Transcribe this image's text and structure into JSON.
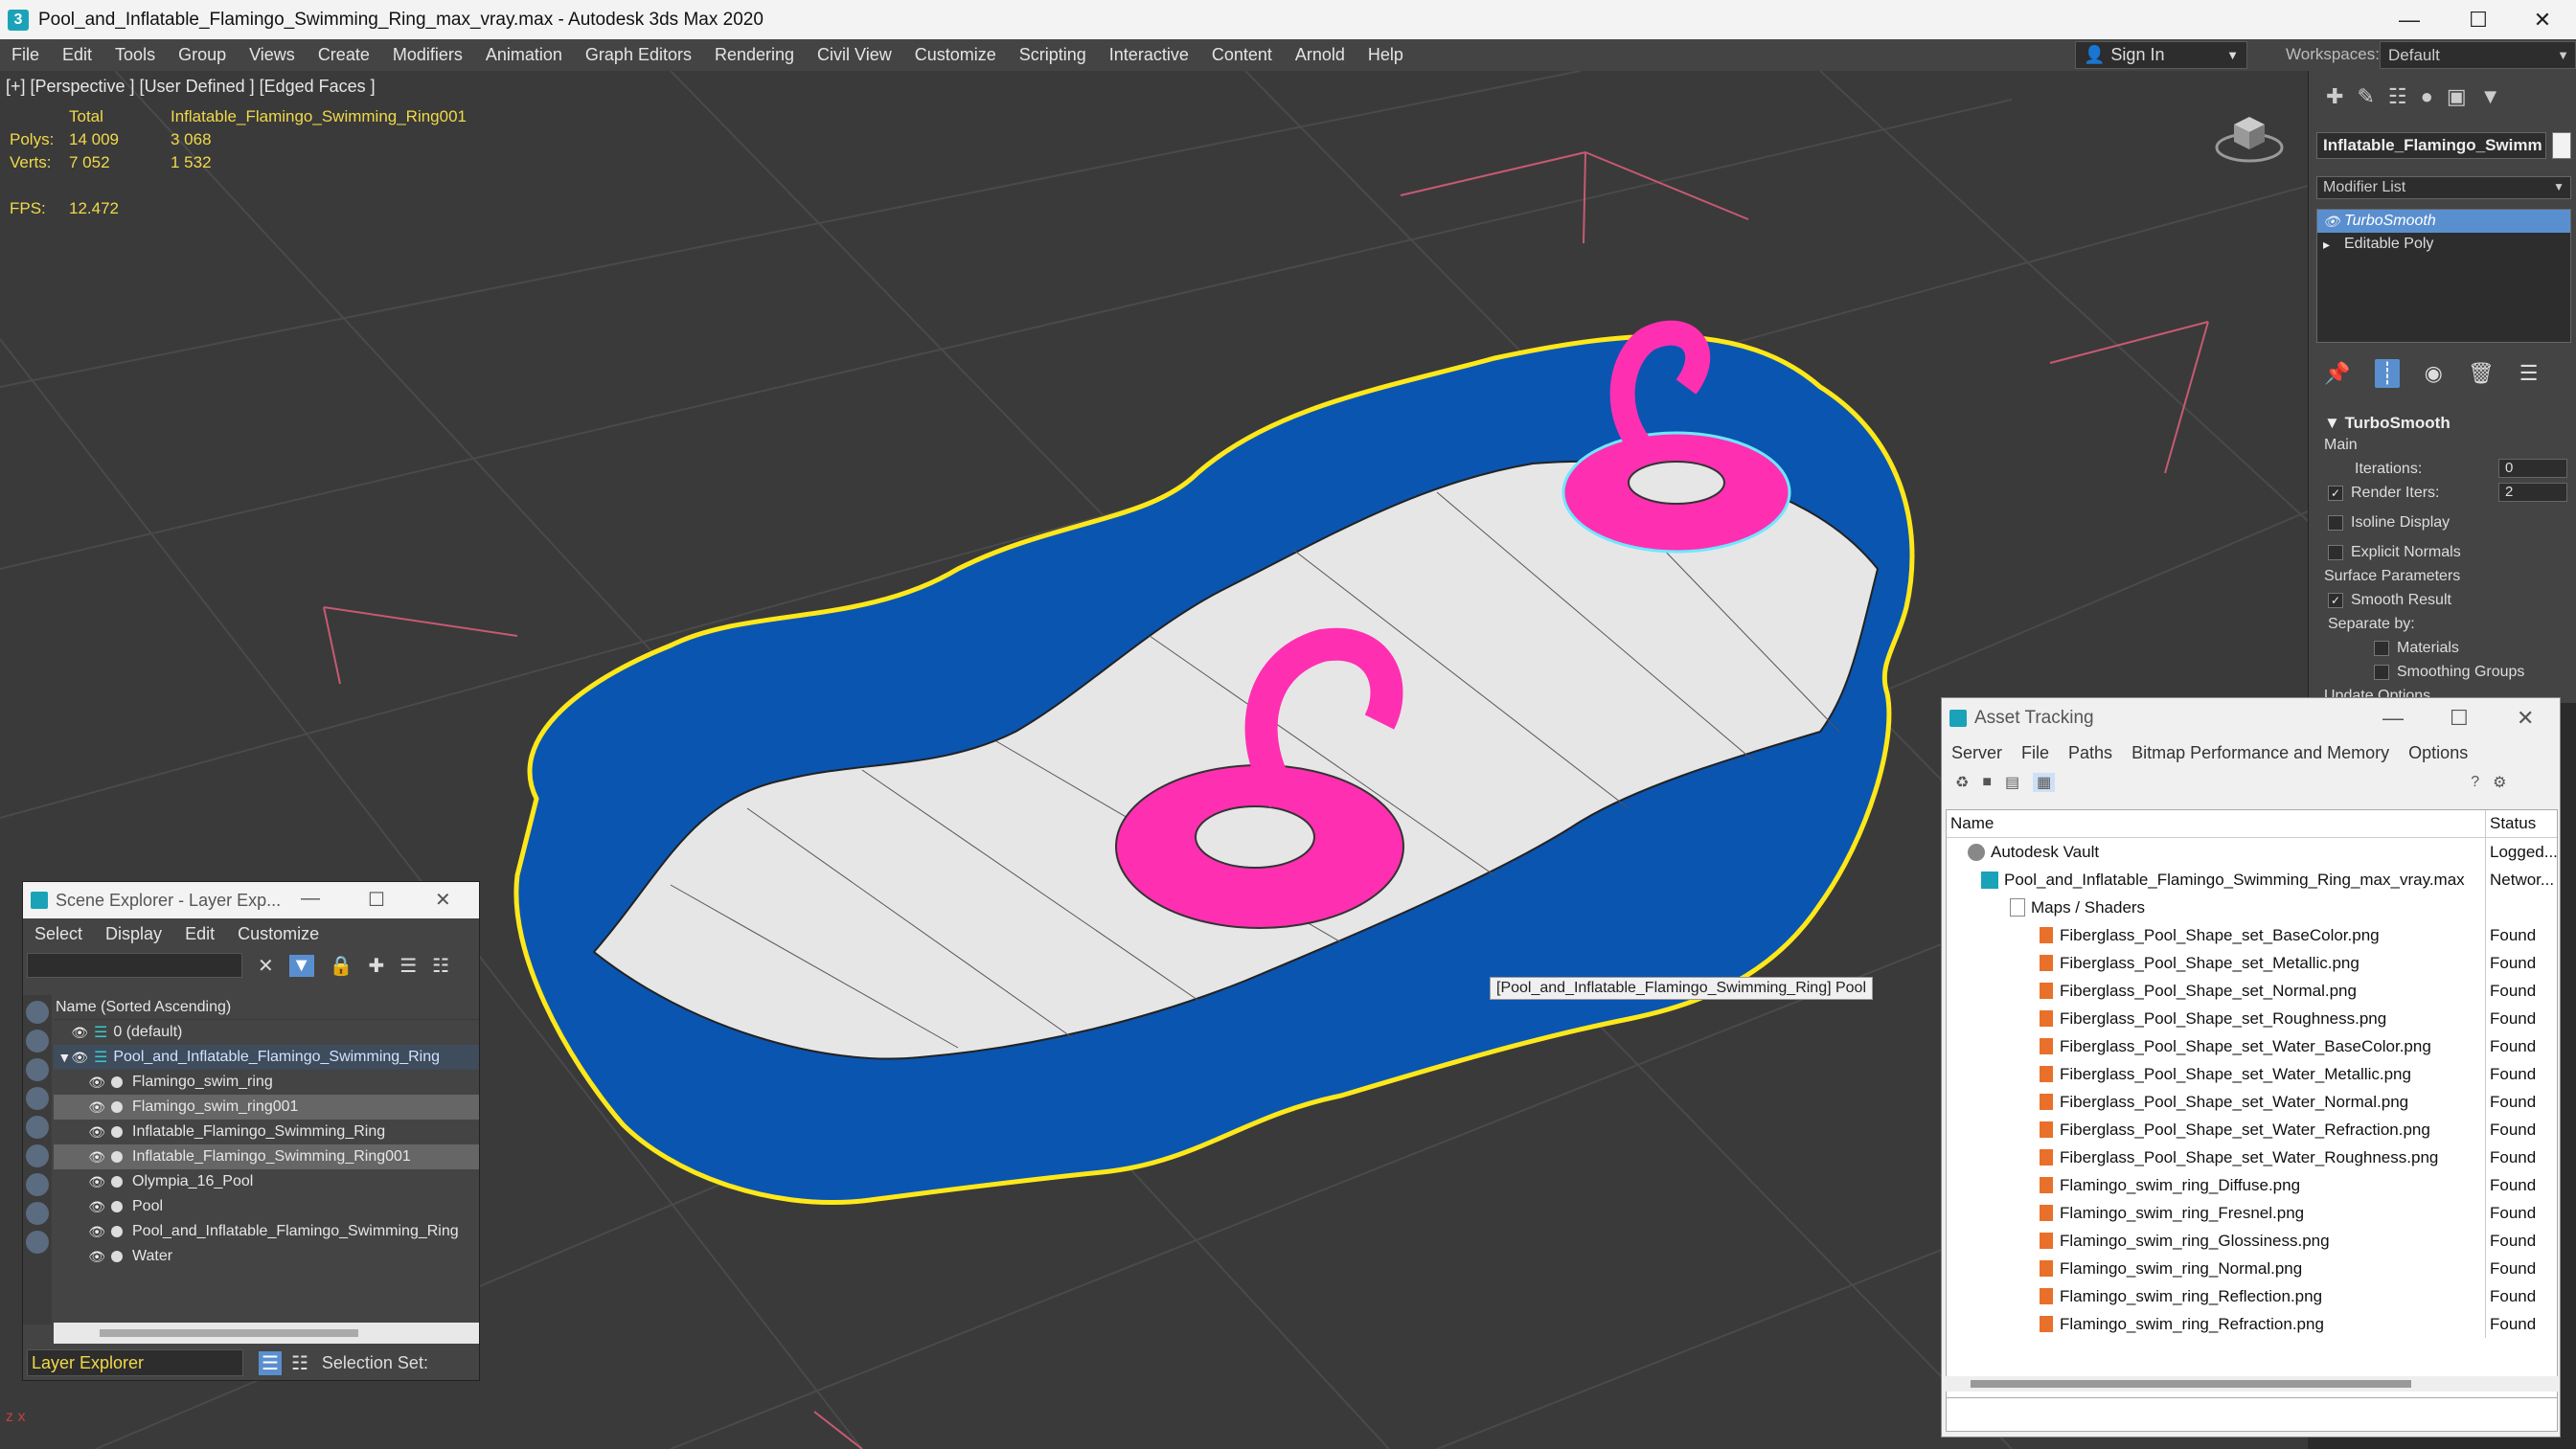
{
  "window": {
    "title": "Pool_and_Inflatable_Flamingo_Swimming_Ring_max_vray.max - Autodesk 3ds Max 2020"
  },
  "menu": {
    "items": [
      "File",
      "Edit",
      "Tools",
      "Group",
      "Views",
      "Create",
      "Modifiers",
      "Animation",
      "Graph Editors",
      "Rendering",
      "Civil View",
      "Customize",
      "Scripting",
      "Interactive",
      "Content",
      "Arnold",
      "Help"
    ]
  },
  "account": {
    "sign_in": "Sign In",
    "workspaces_label": "Workspaces:",
    "workspace": "Default"
  },
  "viewport": {
    "label": "[+] [Perspective ] [User Defined ] [Edged Faces ]",
    "stats": {
      "total_label": "Total",
      "object_label": "Inflatable_Flamingo_Swimming_Ring001",
      "polys_label": "Polys:",
      "polys_total": "14 009",
      "polys_obj": "3 068",
      "verts_label": "Verts:",
      "verts_total": "7 052",
      "verts_obj": "1 532",
      "fps_label": "FPS:",
      "fps": "12.472"
    },
    "tooltip": "[Pool_and_Inflatable_Flamingo_Swimming_Ring] Pool",
    "colors": {
      "pool_blue": "#0a55b0",
      "pool_floor": "#e6e6e6",
      "flamingo": "#ff2fb2",
      "selection": "#ffe81a",
      "grid": "#555555"
    }
  },
  "command_panel": {
    "object_name": "Inflatable_Flamingo_Swimm",
    "modifier_list": "Modifier List",
    "stack": [
      "TurboSmooth",
      "Editable Poly"
    ],
    "rollout": {
      "title": "TurboSmooth",
      "main": "Main",
      "iterations_label": "Iterations:",
      "iterations": "0",
      "render_iters_label": "Render Iters:",
      "render_iters": "2",
      "isoline": "Isoline Display",
      "explicit": "Explicit Normals",
      "surface": "Surface Parameters",
      "smooth_result": "Smooth Result",
      "separate": "Separate by:",
      "materials": "Materials",
      "smoothing": "Smoothing Groups",
      "update": "Update Options"
    }
  },
  "scene_explorer": {
    "title": "Scene Explorer - Layer Exp...",
    "menu": [
      "Select",
      "Display",
      "Edit",
      "Customize"
    ],
    "column": "Name (Sorted Ascending)",
    "rows": [
      {
        "name": "0 (default)"
      },
      {
        "name": "Pool_and_Inflatable_Flamingo_Swimming_Ring"
      },
      {
        "name": "Flamingo_swim_ring"
      },
      {
        "name": "Flamingo_swim_ring001"
      },
      {
        "name": "Inflatable_Flamingo_Swimming_Ring"
      },
      {
        "name": "Inflatable_Flamingo_Swimming_Ring001"
      },
      {
        "name": "Olympia_16_Pool"
      },
      {
        "name": "Pool"
      },
      {
        "name": "Pool_and_Inflatable_Flamingo_Swimming_Ring"
      },
      {
        "name": "Water"
      }
    ],
    "footer_layer": "Layer Explorer",
    "footer_selection": "Selection Set:"
  },
  "asset_tracking": {
    "title": "Asset Tracking",
    "menu": [
      "Server",
      "File",
      "Paths",
      "Bitmap Performance and Memory",
      "Options"
    ],
    "col_name": "Name",
    "col_status": "Status",
    "rows": [
      {
        "name": "Autodesk Vault",
        "status": "Logged..."
      },
      {
        "name": "Pool_and_Inflatable_Flamingo_Swimming_Ring_max_vray.max",
        "status": "Networ..."
      },
      {
        "name": "Maps / Shaders",
        "status": ""
      },
      {
        "name": "Fiberglass_Pool_Shape_set_BaseColor.png",
        "status": "Found"
      },
      {
        "name": "Fiberglass_Pool_Shape_set_Metallic.png",
        "status": "Found"
      },
      {
        "name": "Fiberglass_Pool_Shape_set_Normal.png",
        "status": "Found"
      },
      {
        "name": "Fiberglass_Pool_Shape_set_Roughness.png",
        "status": "Found"
      },
      {
        "name": "Fiberglass_Pool_Shape_set_Water_BaseColor.png",
        "status": "Found"
      },
      {
        "name": "Fiberglass_Pool_Shape_set_Water_Metallic.png",
        "status": "Found"
      },
      {
        "name": "Fiberglass_Pool_Shape_set_Water_Normal.png",
        "status": "Found"
      },
      {
        "name": "Fiberglass_Pool_Shape_set_Water_Refraction.png",
        "status": "Found"
      },
      {
        "name": "Fiberglass_Pool_Shape_set_Water_Roughness.png",
        "status": "Found"
      },
      {
        "name": "Flamingo_swim_ring_Diffuse.png",
        "status": "Found"
      },
      {
        "name": "Flamingo_swim_ring_Fresnel.png",
        "status": "Found"
      },
      {
        "name": "Flamingo_swim_ring_Glossiness.png",
        "status": "Found"
      },
      {
        "name": "Flamingo_swim_ring_Normal.png",
        "status": "Found"
      },
      {
        "name": "Flamingo_swim_ring_Reflection.png",
        "status": "Found"
      },
      {
        "name": "Flamingo_swim_ring_Refraction.png",
        "status": "Found"
      }
    ]
  }
}
